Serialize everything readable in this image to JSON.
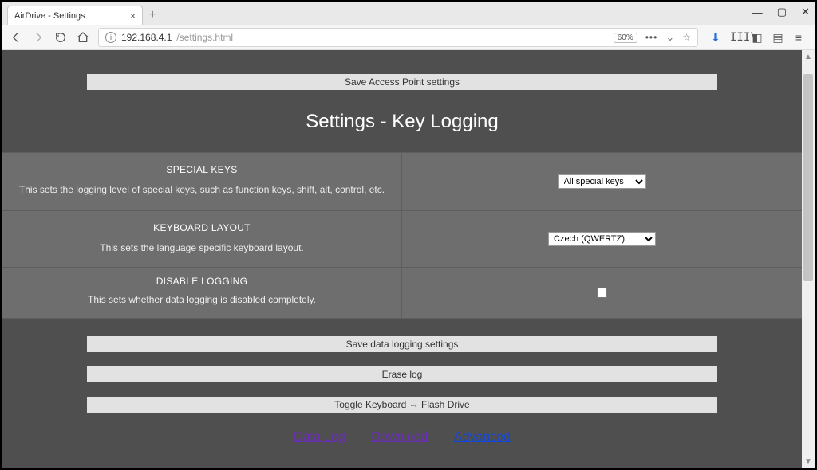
{
  "browser": {
    "tab_title": "AirDrive - Settings",
    "url_domain": "192.168.4.1",
    "url_path": "/settings.html",
    "zoom": "60%"
  },
  "buttons": {
    "save_ap": "Save Access Point settings",
    "save_logging": "Save data logging settings",
    "erase_log": "Erase log",
    "toggle_kb": "Toggle Keyboard ⇔ Flash Drive"
  },
  "page_title": "Settings - Key Logging",
  "rows": {
    "special_keys": {
      "header": "SPECIAL KEYS",
      "desc": "This sets the logging level of special keys, such as function keys, shift, alt, control, etc.",
      "value": "All special keys"
    },
    "layout": {
      "header": "KEYBOARD LAYOUT",
      "desc": "This sets the language specific keyboard layout.",
      "value": "Czech (QWERTZ)"
    },
    "disable": {
      "header": "DISABLE LOGGING",
      "desc": "This sets whether data logging is disabled completely."
    }
  },
  "links": {
    "data_log": "Data Log",
    "download": "Download",
    "advanced": "Advanced"
  }
}
